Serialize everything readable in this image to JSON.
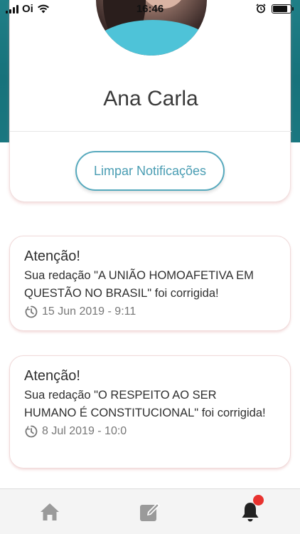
{
  "status_bar": {
    "carrier": "Oi",
    "time": "16:46",
    "battery_level": 0.85
  },
  "profile": {
    "name": "Ana Carla",
    "clear_button_label": "Limpar Notificações"
  },
  "notifications": [
    {
      "title": "Atenção!",
      "message": "Sua redação \"A UNIÃO HOMOAFETIVA EM QUESTÃO NO BRASIL\" foi corrigida!",
      "date": "15 Jun 2019 - 9:11",
      "icon": "clock-icon"
    },
    {
      "title": "Atenção!",
      "message": "Sua redação \"O RESPEITO AO SER HUMANO É CONSTITUCIONAL\" foi corrigida!",
      "date": "8 Jul 2019 - 10:0",
      "icon": "clock-icon"
    }
  ],
  "tab_bar": {
    "tabs": [
      "home-icon",
      "edit-icon",
      "bell-icon"
    ],
    "active_tab": "bell-icon",
    "notification_badge": true
  },
  "colors": {
    "header_teal": "#1a7780",
    "button_accent": "#4a9db3",
    "badge_red": "#e8322f",
    "tab_inactive": "#9a9a9a",
    "tab_active": "#222222"
  }
}
